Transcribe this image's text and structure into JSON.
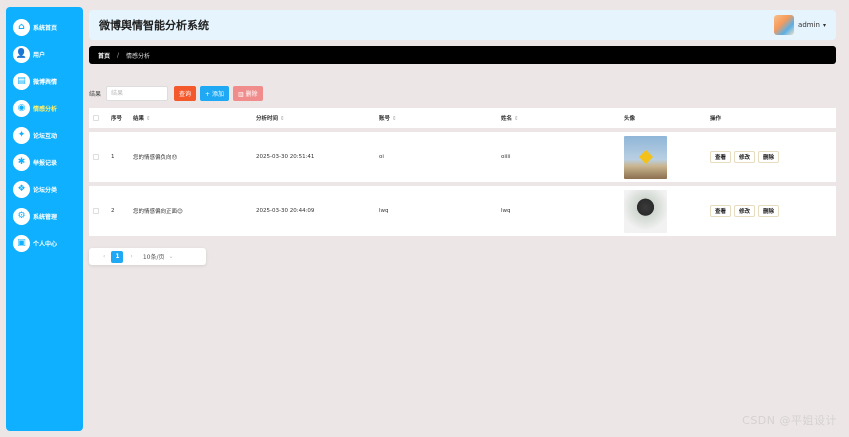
{
  "sidebar": {
    "items": [
      {
        "label": "系统首页",
        "icon": "⌂",
        "icon_name": "home-icon"
      },
      {
        "label": "用户",
        "icon": "👤",
        "icon_name": "user-icon"
      },
      {
        "label": "微博舆情",
        "icon": "▤",
        "icon_name": "list-icon"
      },
      {
        "label": "情感分析",
        "icon": "◉",
        "icon_name": "pin-icon"
      },
      {
        "label": "论坛互动",
        "icon": "✦",
        "icon_name": "chat-icon"
      },
      {
        "label": "举报记录",
        "icon": "✱",
        "icon_name": "flag-icon"
      },
      {
        "label": "论坛分类",
        "icon": "❖",
        "icon_name": "category-icon"
      },
      {
        "label": "系统管理",
        "icon": "⚙",
        "icon_name": "gear-icon"
      },
      {
        "label": "个人中心",
        "icon": "▣",
        "icon_name": "profile-icon"
      }
    ],
    "active_index": 3
  },
  "header": {
    "title": "微博舆情智能分析系统",
    "user": "admin",
    "caret": "▾"
  },
  "breadcrumb": {
    "home": "首页",
    "separator": "/",
    "current": "情感分析"
  },
  "search": {
    "label": "结果",
    "placeholder": "结果",
    "query_label": "查询",
    "add_label": "+ 添加",
    "delete_label": "▥ 删除"
  },
  "table": {
    "columns": {
      "index": "序号",
      "result": "结果",
      "time": "分析时间",
      "account": "账号",
      "name": "姓名",
      "avatar": "头像",
      "ops": "操作"
    },
    "sort_glyph": "⇕",
    "rows": [
      {
        "index": "1",
        "result": "您的情感偏负向😞",
        "time": "2025-03-30 20:51:41",
        "account": "oi",
        "name": "oiiii"
      },
      {
        "index": "2",
        "result": "您的情感偏向正面😊",
        "time": "2025-03-30 20:44:09",
        "account": "lwq",
        "name": "lwq"
      }
    ],
    "ops": {
      "view": "查看",
      "edit": "修改",
      "delete": "删除"
    }
  },
  "pagination": {
    "prev": "‹",
    "current": "1",
    "next": "›",
    "page_size": "10条/页",
    "caret": "⌄"
  },
  "watermark": "CSDN @平姐设计"
}
